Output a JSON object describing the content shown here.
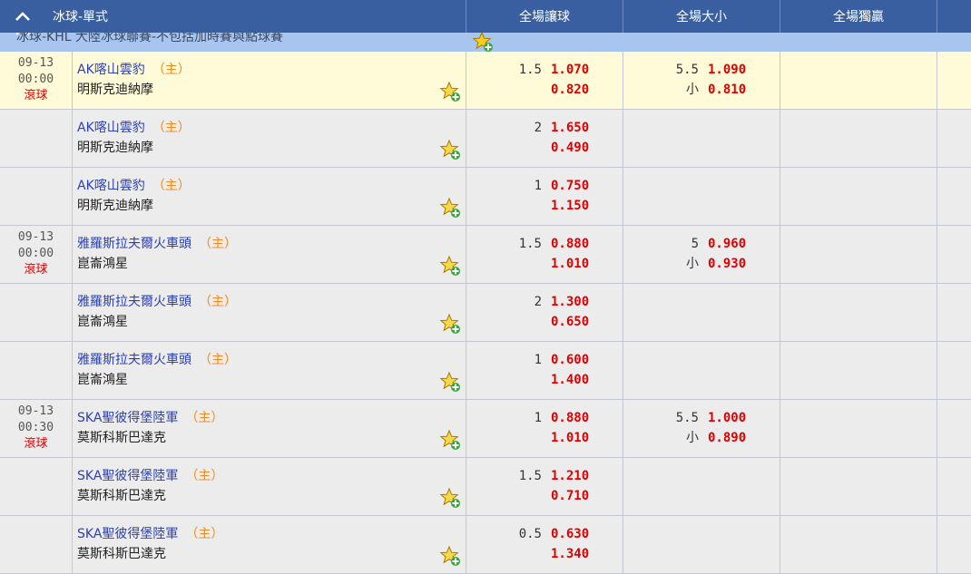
{
  "header": {
    "title": "冰球-單式",
    "col_hdp": "全場讓球",
    "col_ou": "全場大小",
    "col_1x2": "全場獨贏"
  },
  "league": {
    "name": "冰球-KHL 大陸冰球聯賽-不包括加時賽與點球賽"
  },
  "rows": [
    {
      "date": "09-13",
      "time": "00:00",
      "status": "滾球",
      "home": "AK喀山雲豹",
      "home_tag": "（主）",
      "away": "明斯克迪納摩",
      "hdp_line": "1.5",
      "hdp_home": "1.070",
      "hdp_away": "0.820",
      "ou_line": "5.5",
      "ou_over": "1.090",
      "ou_under_label": "小",
      "ou_under": "0.810"
    },
    {
      "date": "",
      "time": "",
      "status": "",
      "home": "AK喀山雲豹",
      "home_tag": "（主）",
      "away": "明斯克迪納摩",
      "hdp_line": "2",
      "hdp_home": "1.650",
      "hdp_away": "0.490",
      "ou_line": "",
      "ou_over": "",
      "ou_under_label": "",
      "ou_under": ""
    },
    {
      "date": "",
      "time": "",
      "status": "",
      "home": "AK喀山雲豹",
      "home_tag": "（主）",
      "away": "明斯克迪納摩",
      "hdp_line": "1",
      "hdp_home": "0.750",
      "hdp_away": "1.150",
      "ou_line": "",
      "ou_over": "",
      "ou_under_label": "",
      "ou_under": ""
    },
    {
      "date": "09-13",
      "time": "00:00",
      "status": "滾球",
      "home": "雅羅斯拉夫爾火車頭",
      "home_tag": "（主）",
      "away": "崑崙鴻星",
      "hdp_line": "1.5",
      "hdp_home": "0.880",
      "hdp_away": "1.010",
      "ou_line": "5",
      "ou_over": "0.960",
      "ou_under_label": "小",
      "ou_under": "0.930"
    },
    {
      "date": "",
      "time": "",
      "status": "",
      "home": "雅羅斯拉夫爾火車頭",
      "home_tag": "（主）",
      "away": "崑崙鴻星",
      "hdp_line": "2",
      "hdp_home": "1.300",
      "hdp_away": "0.650",
      "ou_line": "",
      "ou_over": "",
      "ou_under_label": "",
      "ou_under": ""
    },
    {
      "date": "",
      "time": "",
      "status": "",
      "home": "雅羅斯拉夫爾火車頭",
      "home_tag": "（主）",
      "away": "崑崙鴻星",
      "hdp_line": "1",
      "hdp_home": "0.600",
      "hdp_away": "1.400",
      "ou_line": "",
      "ou_over": "",
      "ou_under_label": "",
      "ou_under": ""
    },
    {
      "date": "09-13",
      "time": "00:30",
      "status": "滾球",
      "home": "SKA聖彼得堡陸軍",
      "home_tag": "（主）",
      "away": "莫斯科斯巴達克",
      "hdp_line": "1",
      "hdp_home": "0.880",
      "hdp_away": "1.010",
      "ou_line": "5.5",
      "ou_over": "1.000",
      "ou_under_label": "小",
      "ou_under": "0.890"
    },
    {
      "date": "",
      "time": "",
      "status": "",
      "home": "SKA聖彼得堡陸軍",
      "home_tag": "（主）",
      "away": "莫斯科斯巴達克",
      "hdp_line": "1.5",
      "hdp_home": "1.210",
      "hdp_away": "0.710",
      "ou_line": "",
      "ou_over": "",
      "ou_under_label": "",
      "ou_under": ""
    },
    {
      "date": "",
      "time": "",
      "status": "",
      "home": "SKA聖彼得堡陸軍",
      "home_tag": "（主）",
      "away": "莫斯科斯巴達克",
      "hdp_line": "0.5",
      "hdp_home": "0.630",
      "hdp_away": "1.340",
      "ou_line": "",
      "ou_over": "",
      "ou_under_label": "",
      "ou_under": ""
    }
  ]
}
